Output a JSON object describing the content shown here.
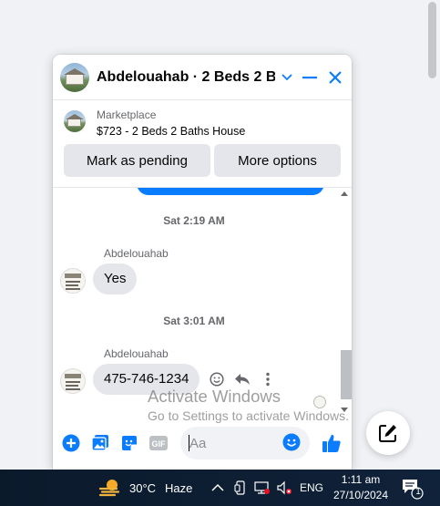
{
  "chat": {
    "title": "Abdelouahab · 2 Beds 2 Ba...",
    "marketplace_label": "Marketplace",
    "listing_title": "$723 - 2 Beds 2 Baths House",
    "mark_pending_label": "Mark as pending",
    "more_options_label": "More options"
  },
  "messages": [
    {
      "timestamp": "Sat 2:19 AM",
      "sender": "Abdelouahab",
      "text": "Yes"
    },
    {
      "timestamp": "Sat 3:01 AM",
      "sender": "Abdelouahab",
      "text": "475-746-1234"
    }
  ],
  "composer": {
    "placeholder": "Aa",
    "gif_label": "GIF"
  },
  "watermark": {
    "title": "Activate Windows",
    "subtitle": "Go to Settings to activate Windows."
  },
  "taskbar": {
    "temperature": "30°C",
    "weather": "Haze",
    "language": "ENG",
    "time": "1:11 am",
    "date": "27/10/2024",
    "notification_count": "1"
  },
  "colors": {
    "messenger_blue": "#0a7cff",
    "button_gray": "#e4e6eb",
    "text_secondary": "#65676b"
  }
}
